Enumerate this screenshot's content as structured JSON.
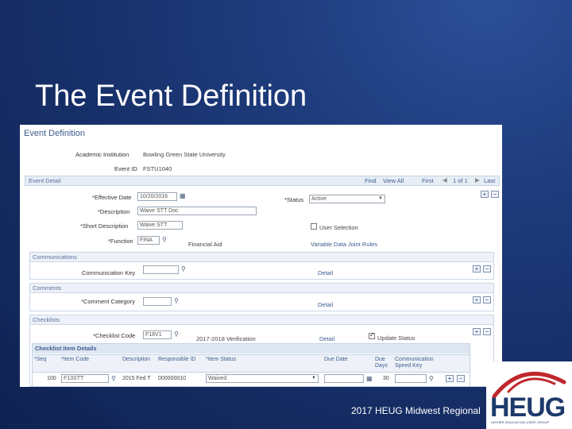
{
  "slide": {
    "title": "The Event Definition",
    "footer": "2017 HEUG Midwest Regional"
  },
  "logo": {
    "text": "HEUG",
    "subtitle": "HIGHER EDUCATION USER GROUP",
    "arc_color": "#c0272d",
    "text_color": "#1d3a6b"
  },
  "screen": {
    "page_title": "Event Definition",
    "academic_institution_label": "Academic Institution",
    "academic_institution_value": "Bowling Green State University",
    "event_id_label": "Event ID",
    "event_id_value": "FSTU1040",
    "event_detail": {
      "title": "Event Detail",
      "find": "Find",
      "view_all": "View All",
      "first": "First",
      "pager": "1 of 1",
      "last": "Last"
    },
    "fields": {
      "effective_date_label": "*Effective Date",
      "effective_date_value": "10/20/2016",
      "status_label": "*Status",
      "status_value": "Active",
      "description_label": "*Description",
      "description_value": "Waive STT Doc",
      "short_description_label": "*Short Description",
      "short_description_value": "Waive STT",
      "user_selection_label": "User Selection",
      "function_label": "*Function",
      "function_value": "FINA",
      "function_desc": "Financial Aid",
      "variable_data_link": "Variable Data Joint Rules"
    },
    "communications": {
      "title": "Communications",
      "key_label": "Communication Key",
      "detail_label": "Detail"
    },
    "comments": {
      "title": "Comments",
      "category_label": "*Comment Category",
      "detail_label": "Detail"
    },
    "checklists": {
      "title": "Checklists",
      "code_label": "*Checklist Code",
      "code_value": "F18V1",
      "code_desc": "2017-2018 Verification",
      "detail_label": "Detail",
      "update_status_label": "Update Status"
    },
    "checklist_items": {
      "title": "Checklist Item Details",
      "headers": [
        "*Seq",
        "*Item Code",
        "Description",
        "Responsible ID",
        "*Item Status",
        "Due Date",
        "Due Days",
        "Communication Speed Key"
      ],
      "row": {
        "seq": "100",
        "item_code": "F13STT",
        "description": "2015 Fed T",
        "responsible_id": "000000010",
        "item_status": "Waived",
        "due_date": "",
        "due_days": "30",
        "speed_key": ""
      }
    }
  }
}
